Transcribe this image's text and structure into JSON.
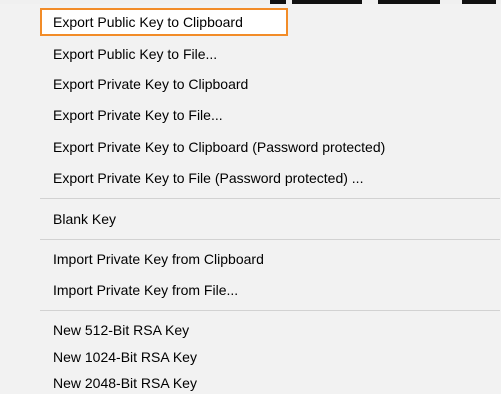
{
  "colors": {
    "menu_background": "#f2f2f2",
    "highlight_border": "#f28c28",
    "separator": "#d2d2d2",
    "text": "#000000"
  },
  "menu": {
    "export_group": [
      "Export Public Key to Clipboard",
      "Export Public Key to File...",
      "Export Private Key to Clipboard",
      "Export Private Key to File...",
      "Export Private Key to Clipboard (Password protected)",
      "Export Private Key to File (Password protected) ..."
    ],
    "blank_group": [
      "Blank Key"
    ],
    "import_group": [
      "Import Private Key from Clipboard",
      "Import Private Key from File..."
    ],
    "new_key_group": [
      "New 512-Bit RSA Key",
      "New 1024-Bit RSA Key",
      "New 2048-Bit RSA Key"
    ]
  }
}
